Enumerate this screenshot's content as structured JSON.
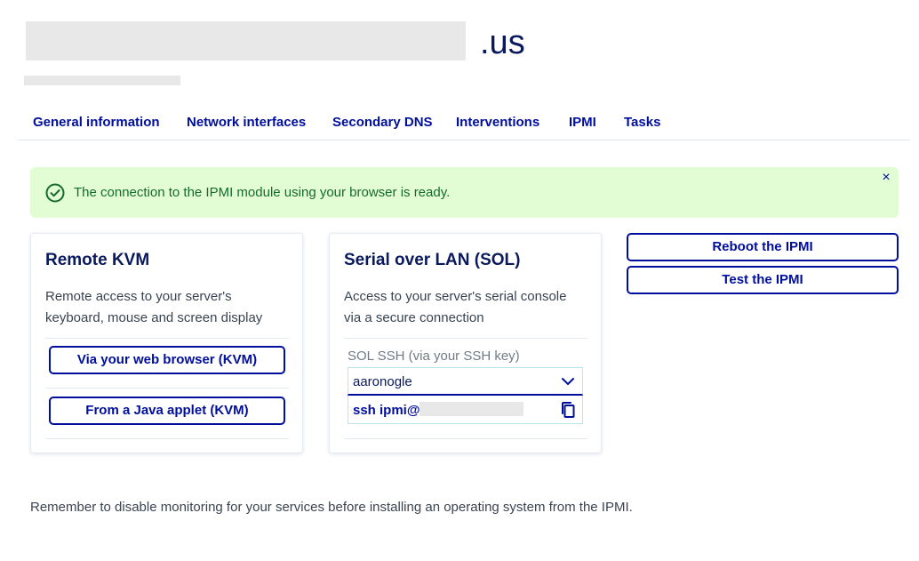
{
  "header": {
    "title_suffix": ".us"
  },
  "tabs": [
    {
      "label": "General information"
    },
    {
      "label": "Network interfaces"
    },
    {
      "label": "Secondary DNS"
    },
    {
      "label": "Interventions"
    },
    {
      "label": "IPMI"
    },
    {
      "label": "Tasks"
    }
  ],
  "alert": {
    "message": "The connection to the IPMI module using your browser is ready.",
    "icon": "check-circle-icon",
    "close_icon": "close-icon",
    "close_glyph": "×",
    "color": "#156b2b",
    "background": "#e2fcd4"
  },
  "kvm_card": {
    "title": "Remote KVM",
    "description": "Remote access to your server's keyboard, mouse and screen display",
    "browser_button": "Via your web browser (KVM)",
    "java_button": "From a Java applet (KVM)"
  },
  "sol_card": {
    "title": "Serial over LAN (SOL)",
    "description": "Access to your server's serial console via a secure connection",
    "select_label": "SOL SSH (via your SSH key)",
    "select_value": "aaronogle",
    "command_prefix": "ssh ipmi@"
  },
  "actions": {
    "reboot_button": "Reboot the IPMI",
    "test_button": "Test the IPMI"
  },
  "footer": {
    "note": "Remember to disable monitoring for your services before installing an operating system from the IPMI."
  },
  "colors": {
    "primary": "#000e9c",
    "success_bg": "#e2fcd4",
    "success_text": "#156b2b"
  }
}
